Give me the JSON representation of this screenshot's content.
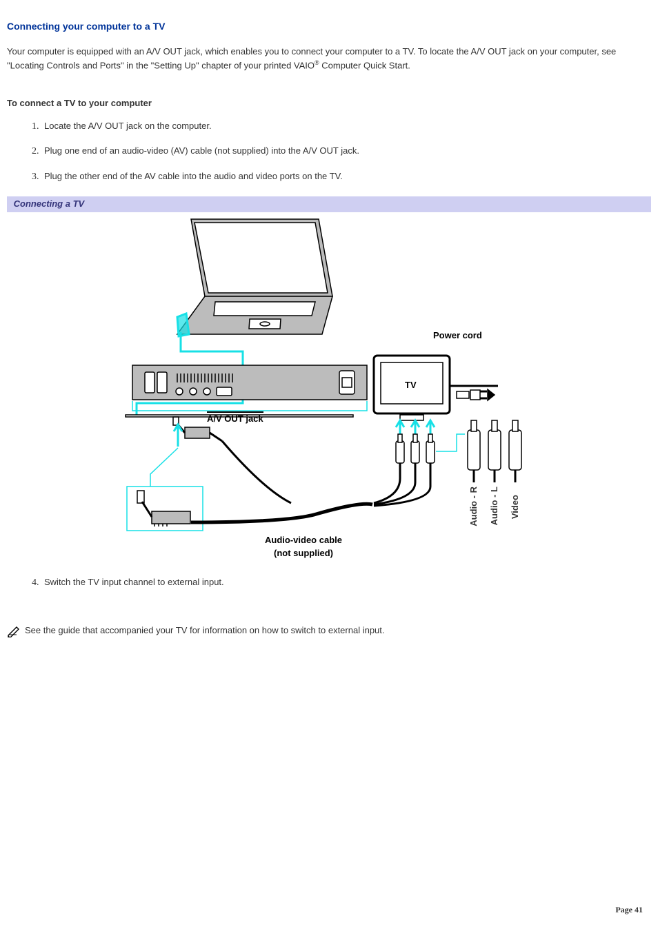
{
  "title_color": "#003399",
  "title": "Connecting your computer to a TV",
  "intro_parts": {
    "a": "Your computer is equipped with an A/V OUT jack, which enables you to connect your computer to a TV. To locate the A/V OUT jack on your computer, see \"Locating Controls and Ports\" in the \"Setting Up\" chapter of your printed VAIO",
    "reg": "®",
    "b": " Computer Quick Start."
  },
  "subheading": "To connect a TV to your computer",
  "steps": [
    "Locate the A/V OUT jack on the computer.",
    "Plug one end of an audio-video (AV) cable (not supplied) into the A/V OUT jack.",
    "Plug the other end of the AV cable into the audio and video ports on the TV."
  ],
  "figure_caption": "Connecting a TV",
  "figure_labels": {
    "power_cord": "Power cord",
    "tv": "TV",
    "av_out": "A/V OUT jack",
    "av_cable_line1": "Audio-video cable",
    "av_cable_line2": "(not supplied)",
    "audio_r": "Audio - R",
    "audio_l": "Audio - L",
    "video": "Video"
  },
  "connector_colors": {
    "audio_r": "#b51614",
    "audio_l": "#ffffff",
    "video": "#f5d21b"
  },
  "step4": "Switch the TV input channel to external input.",
  "note_icon": "note-icon",
  "note": "See the guide that accompanied your TV for information on how to switch to external input.",
  "page_label": "Page 41"
}
